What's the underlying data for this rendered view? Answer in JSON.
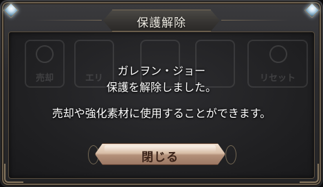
{
  "dialog": {
    "title": "保護解除",
    "message_line1": "ガレヲン・ジョー",
    "message_line2": "保護を解除しました。",
    "message_line3": "売却や強化素材に使用することができます。",
    "close_label": "閉じる"
  },
  "background_menu": {
    "items": [
      {
        "label": "売却"
      },
      {
        "label": "エリ"
      },
      {
        "label": ""
      },
      {
        "label": ""
      },
      {
        "label": ""
      },
      {
        "label": "リセット"
      }
    ]
  },
  "colors": {
    "accent_gem": "#cfe4f2",
    "button_face": "#d9bfa8",
    "button_text": "#3a2218",
    "frame": "#6f6250"
  }
}
